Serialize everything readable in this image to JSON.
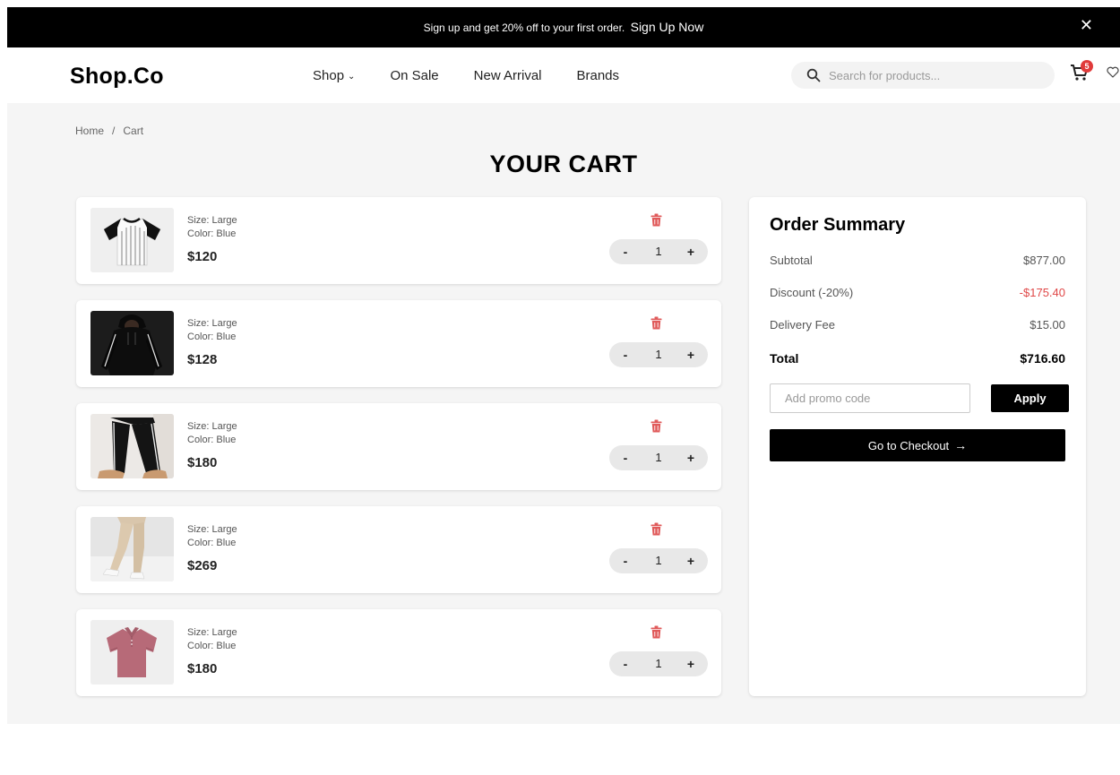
{
  "promo_bar": {
    "text": "Sign up and get 20% off to your first order.",
    "link": "Sign Up Now",
    "close": "✕"
  },
  "header": {
    "logo": "Shop.Co",
    "nav": [
      {
        "label": "Shop",
        "has_dropdown": true
      },
      {
        "label": "On Sale"
      },
      {
        "label": "New Arrival"
      },
      {
        "label": "Brands"
      }
    ],
    "search_placeholder": "Search for products...",
    "cart_count": "5",
    "icons": [
      "search-icon",
      "cart-icon",
      "heart-icon",
      "chevron-down-icon"
    ]
  },
  "breadcrumb": {
    "home": "Home",
    "separator": "/",
    "current": "Cart"
  },
  "page_title": "YOUR CART",
  "cart_items": [
    {
      "size": "Size: Large",
      "color": "Color: Blue",
      "price": "$120",
      "quantity": "1",
      "image": "striped-raglan-tshirt"
    },
    {
      "size": "Size: Large",
      "color": "Color: Blue",
      "price": "$128",
      "quantity": "1",
      "image": "black-hoodie"
    },
    {
      "size": "Size: Large",
      "color": "Color: Blue",
      "price": "$180",
      "quantity": "1",
      "image": "black-track-pants"
    },
    {
      "size": "Size: Large",
      "color": "Color: Blue",
      "price": "$269",
      "quantity": "1",
      "image": "beige-joggers"
    },
    {
      "size": "Size: Large",
      "color": "Color: Blue",
      "price": "$180",
      "quantity": "1",
      "image": "pink-polo-shirt"
    }
  ],
  "stepper": {
    "minus": "-",
    "plus": "+"
  },
  "summary": {
    "title": "Order Summary",
    "subtotal_label": "Subtotal",
    "subtotal_value": "$877.00",
    "discount_label": "Discount (-20%)",
    "discount_value": "-$175.40",
    "delivery_label": "Delivery Fee",
    "delivery_value": "$15.00",
    "total_label": "Total",
    "total_value": "$716.60",
    "promo_placeholder": "Add promo code",
    "apply_label": "Apply",
    "checkout_label": "Go to Checkout",
    "checkout_arrow": "→"
  },
  "colors": {
    "accent": "#000000",
    "discount": "#e04848",
    "trash": "#e05a5a",
    "badge": "#e03b3b",
    "page_bg": "#f5f5f5"
  }
}
